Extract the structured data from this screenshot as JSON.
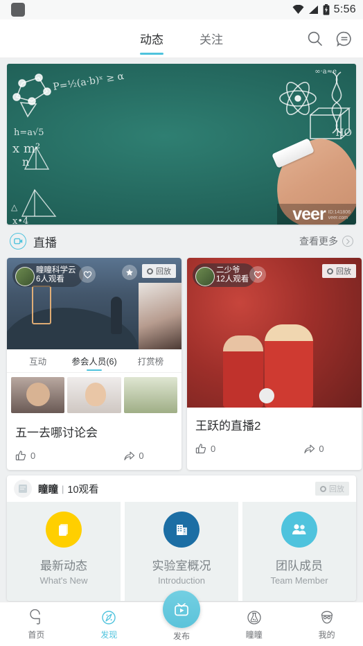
{
  "status_bar": {
    "time": "5:56",
    "icons": [
      "app-square-icon",
      "wifi-icon",
      "cellular-signal-icon",
      "battery-icon"
    ]
  },
  "top_bar": {
    "tabs": [
      {
        "label": "动态",
        "active": true
      },
      {
        "label": "关注",
        "active": false
      }
    ],
    "icons": [
      "search-icon",
      "message-icon"
    ]
  },
  "banner": {
    "watermark": "veer",
    "watermark_sub_1": "ID:141806",
    "watermark_sub_2": "veer.com",
    "alt": "green chalkboard with science formulas and a hand holding chalk"
  },
  "live_section": {
    "title": "直播",
    "more_label": "查看更多"
  },
  "live_cards": [
    {
      "author": "瞳瞳科学云",
      "watch_count": "6人观看",
      "replay_badge": "回放",
      "has_star": true,
      "inner_tabs": [
        {
          "label": "互动",
          "active": false
        },
        {
          "label": "参会人员(6)",
          "active": true
        },
        {
          "label": "打赏榜",
          "active": false
        }
      ],
      "title": "五一去哪讨论会",
      "like_count": "0",
      "share_count": "0"
    },
    {
      "author": "二少爷",
      "watch_count": "12人观看",
      "replay_badge": "回放",
      "has_star": false,
      "inner_tabs": [],
      "title": "王跃的直播2",
      "like_count": "0",
      "share_count": "0"
    }
  ],
  "lab_card": {
    "name": "瞳瞳",
    "separator": "|",
    "watch": "10观看",
    "replay_badge": "回放",
    "tiles": [
      {
        "cn": "最新动态",
        "en": "What's New",
        "color": "#ffcf00",
        "icon": "documents-icon"
      },
      {
        "cn": "实验室概况",
        "en": "Introduction",
        "color": "#1c6ea4",
        "icon": "building-icon"
      },
      {
        "cn": "团队成员",
        "en": "Team Member",
        "color": "#4fc3dd",
        "icon": "people-icon"
      }
    ]
  },
  "bottom_nav": {
    "items": [
      {
        "label": "首页",
        "icon": "home-icon",
        "active": false
      },
      {
        "label": "发现",
        "icon": "discover-icon",
        "active": true
      },
      {
        "label": "发布",
        "icon": "publish-tv-icon",
        "active": false
      },
      {
        "label": "瞳瞳",
        "icon": "flask-icon",
        "active": false
      },
      {
        "label": "我的",
        "icon": "profile-icon",
        "active": false
      }
    ]
  },
  "colors": {
    "accent": "#4fc3dd",
    "text_primary": "#2c2e30",
    "text_secondary": "#6f7276",
    "page_bg": "#eef0f1"
  }
}
